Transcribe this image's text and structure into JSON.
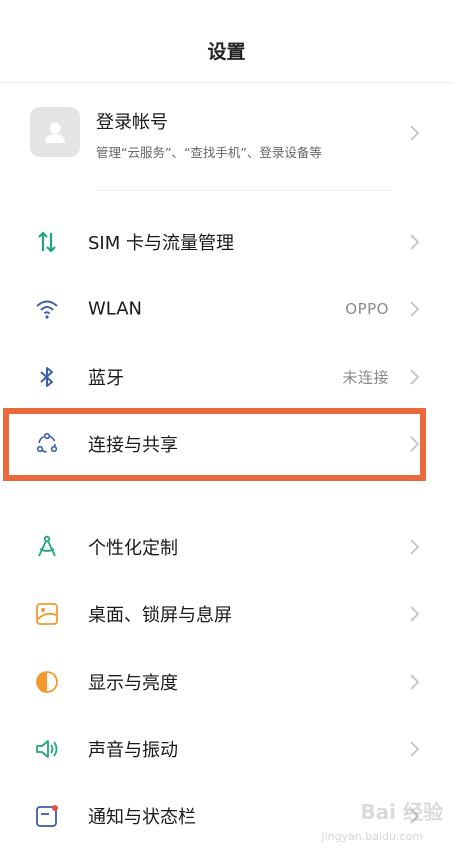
{
  "header": {
    "title": "设置"
  },
  "account": {
    "title": "登录帐号",
    "subtitle": "管理“云服务”、“查找手机”、登录设备等"
  },
  "items": [
    {
      "label": "SIM 卡与流量管理",
      "value": "",
      "icon": "sim-traffic-icon"
    },
    {
      "label": "WLAN",
      "value": "OPPO",
      "icon": "wifi-icon"
    },
    {
      "label": "蓝牙",
      "value": "未连接",
      "icon": "bluetooth-icon"
    },
    {
      "label": "连接与共享",
      "value": "",
      "icon": "connection-share-icon"
    },
    {
      "label": "个性化定制",
      "value": "",
      "icon": "personalization-icon"
    },
    {
      "label": "桌面、锁屏与息屏",
      "value": "",
      "icon": "wallpaper-icon"
    },
    {
      "label": "显示与亮度",
      "value": "",
      "icon": "display-brightness-icon"
    },
    {
      "label": "声音与振动",
      "value": "",
      "icon": "sound-icon"
    },
    {
      "label": "通知与状态栏",
      "value": "",
      "icon": "notification-icon"
    }
  ],
  "watermark": {
    "main": "Bai 经验",
    "sub": "jingyan.baidu.com"
  },
  "colors": {
    "accent_green": "#1fa67a",
    "highlight": "#ea6a3c",
    "icon_blue": "#3b5fa8",
    "icon_orange": "#f29a2e"
  }
}
